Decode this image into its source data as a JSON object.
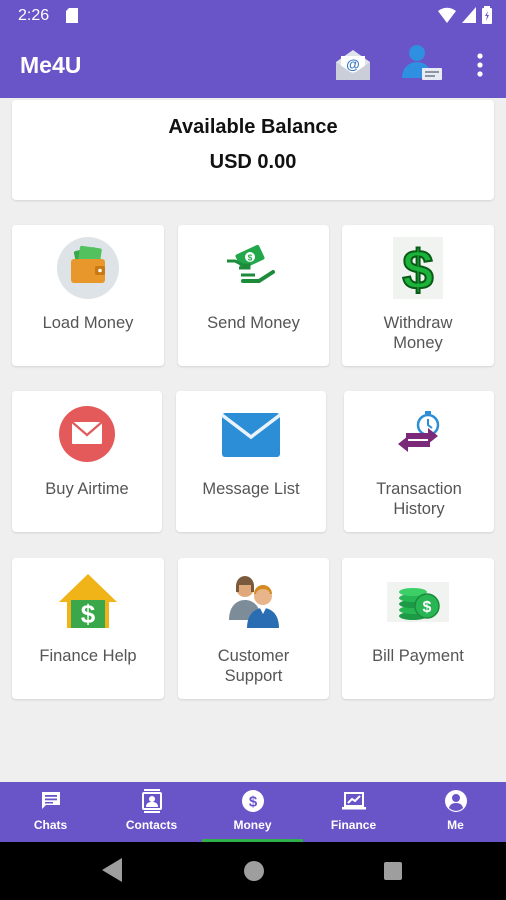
{
  "status_bar": {
    "time": "2:26"
  },
  "app_bar": {
    "title": "Me4U"
  },
  "balance": {
    "label": "Available Balance",
    "amount": "USD 0.00"
  },
  "tiles": [
    {
      "label": "Load Money"
    },
    {
      "label": "Send Money"
    },
    {
      "label": "Withdraw\nMoney"
    },
    {
      "label": "Buy Airtime"
    },
    {
      "label": "Message List"
    },
    {
      "label": "Transaction\nHistory"
    },
    {
      "label": "Finance Help"
    },
    {
      "label": "Customer\nSupport"
    },
    {
      "label": "Bill Payment"
    }
  ],
  "bottom_nav": [
    {
      "label": "Chats"
    },
    {
      "label": "Contacts"
    },
    {
      "label": "Money"
    },
    {
      "label": "Finance"
    },
    {
      "label": "Me"
    }
  ],
  "active_nav": "Money",
  "colors": {
    "primary": "#6a55c8",
    "accent": "#2fb04a"
  }
}
